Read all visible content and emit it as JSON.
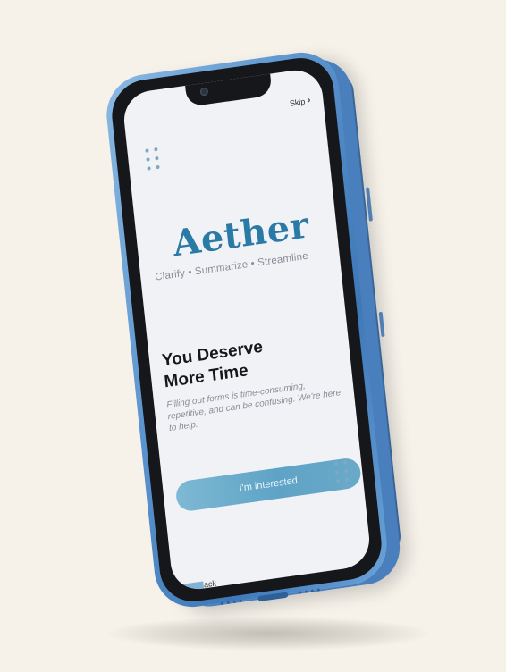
{
  "skip": {
    "label": "Skip",
    "icon": "chevron-right-icon"
  },
  "brand": {
    "name": "Aether",
    "tagline": "Clarify • Summarize • Streamline",
    "color": "#2a7aa6"
  },
  "onboarding": {
    "headline_line1": "You Deserve",
    "headline_line2": "More Time",
    "body": "Filling out forms is time-consuming, repetitive, and can be confusing. We're here to help.",
    "cta_label": "I'm interested"
  },
  "back": {
    "label": "Back",
    "icon": "chevron-left-icon"
  },
  "colors": {
    "background": "#f6f2ea",
    "phone_body": "#5f97cf",
    "screen": "#f1f2f6",
    "accent": "#5ea3c6"
  }
}
